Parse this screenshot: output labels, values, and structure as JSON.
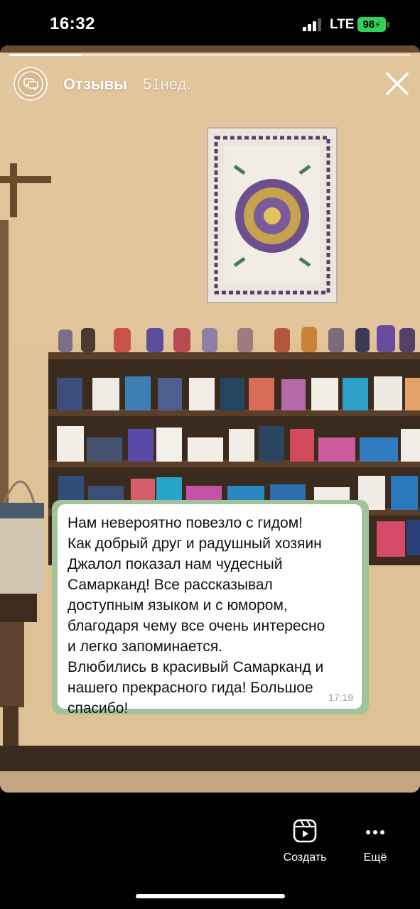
{
  "status_bar": {
    "time": "16:32",
    "network": "LTE",
    "battery": "98"
  },
  "story": {
    "progress": 0.18,
    "account_name": "Отзывы",
    "posted_ago": "51нед.",
    "avatar_icon": "chat-bubbles-icon",
    "close_icon": "close-icon"
  },
  "review": {
    "text": "Нам невероятно повезло с гидом!\nКак добрый друг и радушный хозяин\nДжалол показал нам чудесный\nСамарканд! Все рассказывал\nдоступным языком и с юмором,\nблагодаря чему все очень интересно\nи легко запоминается.\nВлюбились в красивый Самарканд и\nнашего прекрасного гида! Большое\nспасибо!",
    "time": "17:19"
  },
  "actions": {
    "create_label": "Создать",
    "more_label": "Ещё"
  },
  "colors": {
    "battery": "#30d158",
    "wall": "#dfc196",
    "shelf": "#3b2a1e",
    "card_border": "#a2c29c"
  }
}
